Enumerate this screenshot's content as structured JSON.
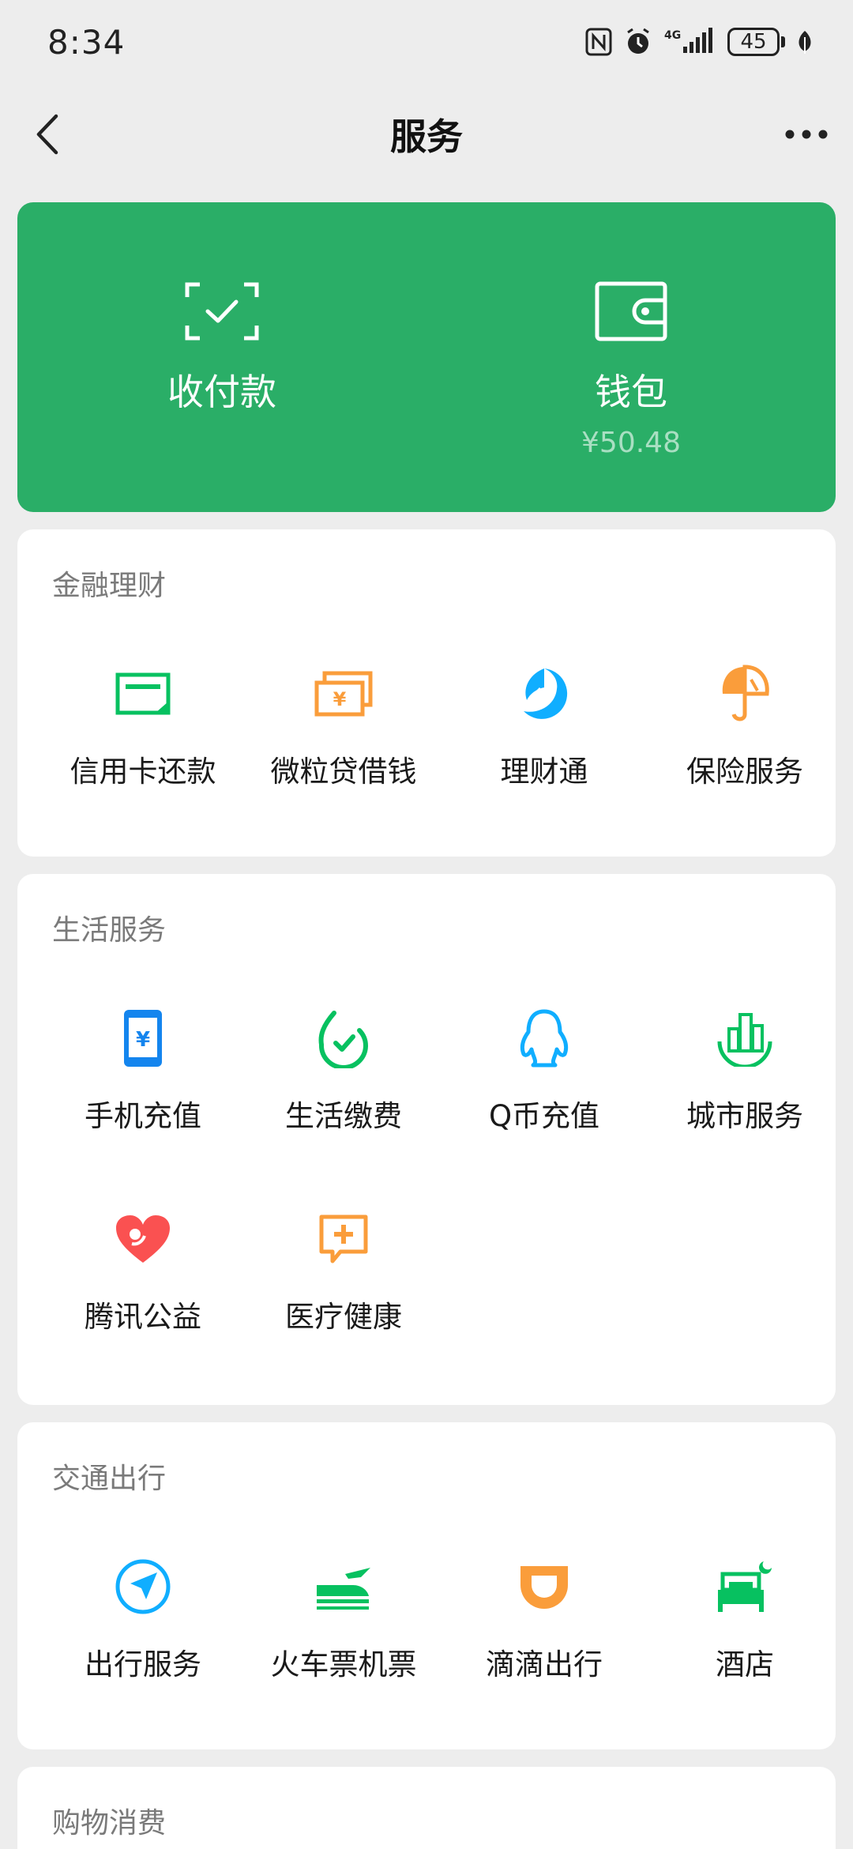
{
  "status_bar": {
    "time": "8:34",
    "battery": "45",
    "network": "4G"
  },
  "nav": {
    "title": "服务"
  },
  "pay_card": {
    "receive_label": "收付款",
    "wallet_label": "钱包",
    "wallet_balance": "¥50.48"
  },
  "sections": {
    "finance": {
      "title": "金融理财",
      "items": [
        {
          "label": "信用卡还款",
          "icon": "credit-card-icon",
          "color": "#07c160"
        },
        {
          "label": "微粒贷借钱",
          "icon": "cash-icon",
          "color": "#fa9d3b"
        },
        {
          "label": "理财通",
          "icon": "wealth-icon",
          "color": "#10aeff"
        },
        {
          "label": "保险服务",
          "icon": "umbrella-icon",
          "color": "#fa9d3b"
        }
      ]
    },
    "life": {
      "title": "生活服务",
      "items": [
        {
          "label": "手机充值",
          "icon": "phone-recharge-icon",
          "color": "#1485ee"
        },
        {
          "label": "生活缴费",
          "icon": "utility-bill-icon",
          "color": "#07c160"
        },
        {
          "label": "Q币充值",
          "icon": "qq-penguin-icon",
          "color": "#10aeff"
        },
        {
          "label": "城市服务",
          "icon": "city-icon",
          "color": "#07c160"
        },
        {
          "label": "腾讯公益",
          "icon": "charity-heart-icon",
          "color": "#fa5151"
        },
        {
          "label": "医疗健康",
          "icon": "medical-icon",
          "color": "#fa9d3b"
        }
      ]
    },
    "travel": {
      "title": "交通出行",
      "items": [
        {
          "label": "出行服务",
          "icon": "navigation-icon",
          "color": "#10aeff"
        },
        {
          "label": "火车票机票",
          "icon": "train-plane-icon",
          "color": "#07c160"
        },
        {
          "label": "滴滴出行",
          "icon": "didi-icon",
          "color": "#fa9d3b"
        },
        {
          "label": "酒店",
          "icon": "hotel-bed-icon",
          "color": "#07c160"
        }
      ]
    },
    "shopping": {
      "title": "购物消费"
    }
  }
}
